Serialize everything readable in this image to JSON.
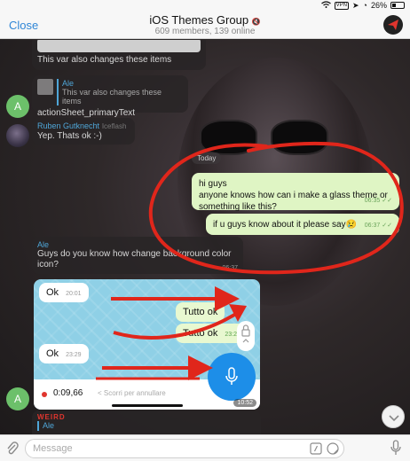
{
  "status": {
    "vpn": "VPN",
    "battery": "26%"
  },
  "header": {
    "close_label": "Close",
    "title": "iOS Themes Group",
    "subtitle": "609 members, 139 online"
  },
  "messages": {
    "m1": {
      "text": "This var also changes these items"
    },
    "m2": {
      "reply_name": "Ale",
      "reply_text": "This var also changes these items",
      "text": "actionSheet_primaryText"
    },
    "m3": {
      "sender": "Ruben Gutknecht",
      "sender_tag": "Iceflash",
      "text": "Yep. Thats ok :-)"
    },
    "date": "Today",
    "m4": {
      "text": "hi guys\nanyone knows how can i make a glass theme or something like this?",
      "time": "06:35"
    },
    "m5": {
      "text": "if u guys know about it please say😢",
      "time": "06:37"
    },
    "m6": {
      "sender": "Ale",
      "text": "Guys do you know how change background color icon?",
      "time": "06:37"
    },
    "m7": {
      "label": "WEIRD",
      "reply_name": "Ale"
    }
  },
  "embed": {
    "b1": {
      "text": "Ok",
      "time": "20:01"
    },
    "b2": {
      "text": "Tutto ok",
      "time": "23:28"
    },
    "b3": {
      "text": "Tutto ok",
      "time": "23:28"
    },
    "b4": {
      "text": "Ok",
      "time": "23:29"
    },
    "rec_time": "0:09,66",
    "rec_hint": "< Scorri per annullare",
    "shot_time": "10:52"
  },
  "avatars": {
    "a_letter": "A"
  },
  "composer": {
    "placeholder": "Message"
  },
  "colors": {
    "accent": "#2f86d6",
    "bubble_out": "#dff5c4",
    "annotation": "#e0261b"
  }
}
